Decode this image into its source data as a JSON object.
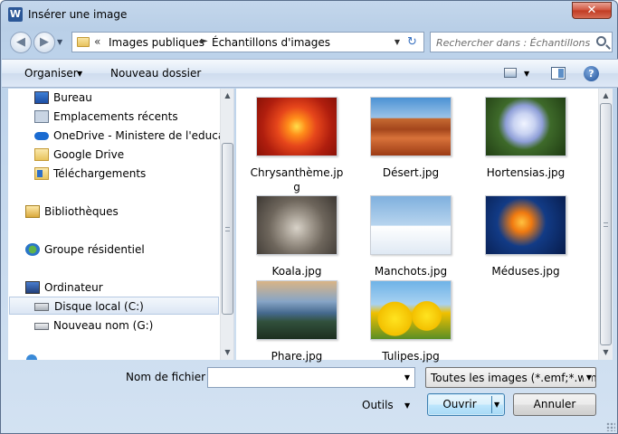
{
  "window": {
    "title": "Insérer une image",
    "app_icon_letter": "W",
    "close_glyph": "✕"
  },
  "nav": {
    "back_glyph": "◀",
    "forward_glyph": "▶",
    "dropdown_glyph": "▼",
    "breadcrumb_prefix": "«",
    "breadcrumb": [
      "Images publiques",
      "Échantillons d'images"
    ],
    "separator_glyph": "►",
    "refresh_glyph": "↻",
    "search_placeholder": "Rechercher dans : Échantillons..."
  },
  "toolbar": {
    "organize_label": "Organiser",
    "new_folder_label": "Nouveau dossier",
    "dropdown_glyph": "▼",
    "help_glyph": "?"
  },
  "sidebar": {
    "items": [
      {
        "label": "Bureau",
        "icon": "desktop-icon"
      },
      {
        "label": "Emplacements récents",
        "icon": "recent-places-icon"
      },
      {
        "label": "OneDrive - Ministere de l'education",
        "icon": "onedrive-icon"
      },
      {
        "label": "Google Drive",
        "icon": "folder-icon"
      },
      {
        "label": "Téléchargements",
        "icon": "downloads-icon"
      },
      {
        "label": "Bibliothèques",
        "icon": "libraries-icon"
      },
      {
        "label": "Groupe résidentiel",
        "icon": "homegroup-icon"
      },
      {
        "label": "Ordinateur",
        "icon": "computer-icon"
      },
      {
        "label": "Disque local (C:)",
        "icon": "local-disk-icon",
        "selected": true
      },
      {
        "label": "Nouveau nom (G:)",
        "icon": "drive-icon"
      }
    ],
    "scroll_up_glyph": "▲",
    "scroll_down_glyph": "▼"
  },
  "files": [
    {
      "name": "Chrysanthème.jpg",
      "thumb": "chrysanthemum"
    },
    {
      "name": "Désert.jpg",
      "thumb": "desert"
    },
    {
      "name": "Hortensias.jpg",
      "thumb": "hydrangeas"
    },
    {
      "name": "Koala.jpg",
      "thumb": "koala"
    },
    {
      "name": "Manchots.jpg",
      "thumb": "penguins"
    },
    {
      "name": "Méduses.jpg",
      "thumb": "jellyfish"
    },
    {
      "name": "Phare.jpg",
      "thumb": "lighthouse"
    },
    {
      "name": "Tulipes.jpg",
      "thumb": "tulips"
    }
  ],
  "footer": {
    "filename_label": "Nom de fichier :",
    "filename_value": "",
    "filter_value": "Toutes les images (*.emf;*.wmf",
    "tools_label": "Outils",
    "open_label": "Ouvrir",
    "cancel_label": "Annuler",
    "dropdown_glyph": "▼"
  },
  "colors": {
    "frame": "#bcd2ea",
    "selection": "#dbe6f4",
    "open_button": "#bee6fd"
  }
}
